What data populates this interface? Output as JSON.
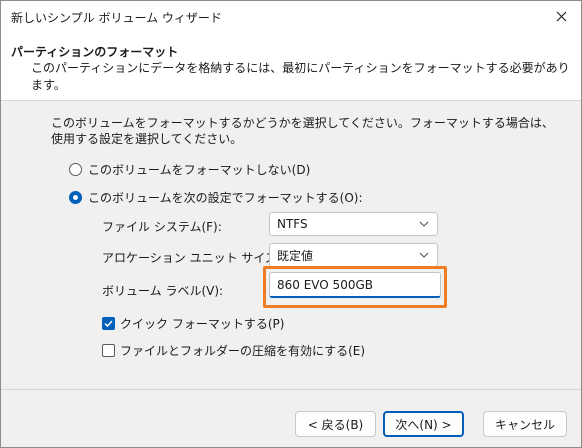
{
  "window": {
    "title": "新しいシンプル ボリューム ウィザード",
    "close_icon": "close-icon"
  },
  "header": {
    "title": "パーティションのフォーマット",
    "subtitle": "このパーティションにデータを格納するには、最初にパーティションをフォーマットする必要があります。"
  },
  "instruction": "このボリュームをフォーマットするかどうかを選択してください。フォーマットする場合は、使用する設定を選択してください。",
  "options": {
    "no_format_label": "このボリュームをフォーマットしない(D)",
    "format_label": "このボリュームを次の設定でフォーマットする(O):",
    "selected": "format"
  },
  "fields": {
    "file_system_label": "ファイル システム(F):",
    "file_system_value": "NTFS",
    "allocation_label": "アロケーション ユニット サイズ(A):",
    "allocation_value": "既定値",
    "volume_label_label": "ボリューム ラベル(V):",
    "volume_label_value": "860 EVO 500GB"
  },
  "checkboxes": {
    "quick_format_label": "クイック フォーマットする(P)",
    "quick_format_checked": true,
    "compression_label": "ファイルとフォルダーの圧縮を有効にする(E)",
    "compression_checked": false
  },
  "buttons": {
    "back": "< 戻る(B)",
    "next": "次へ(N) >",
    "cancel": "キャンセル"
  },
  "colors": {
    "accent": "#005fb8",
    "highlight": "#f07d23"
  }
}
